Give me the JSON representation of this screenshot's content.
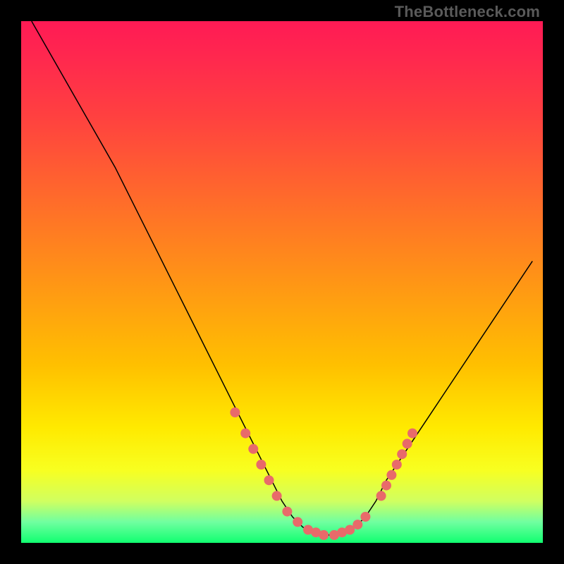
{
  "watermark": "TheBottleneck.com",
  "chart_data": {
    "type": "line",
    "title": "",
    "xlabel": "",
    "ylabel": "",
    "xlim": [
      0,
      100
    ],
    "ylim": [
      0,
      100
    ],
    "series": [
      {
        "name": "curve",
        "x": [
          2,
          6,
          10,
          14,
          18,
          22,
          26,
          30,
          34,
          38,
          42,
          46,
          50,
          52,
          54,
          56,
          58,
          60,
          62,
          64,
          66,
          68,
          70,
          74,
          78,
          82,
          86,
          90,
          94,
          98
        ],
        "y": [
          100,
          93,
          86,
          79,
          72,
          64,
          56,
          48,
          40,
          32,
          24,
          16,
          8,
          5,
          3,
          2,
          1.5,
          1.5,
          2,
          3,
          5,
          8,
          12,
          18,
          24,
          30,
          36,
          42,
          48,
          54
        ]
      }
    ],
    "markers": {
      "name": "highlighted-points",
      "color": "#e86a6a",
      "points": [
        {
          "x": 41,
          "y": 25
        },
        {
          "x": 43,
          "y": 21
        },
        {
          "x": 44.5,
          "y": 18
        },
        {
          "x": 46,
          "y": 15
        },
        {
          "x": 47.5,
          "y": 12
        },
        {
          "x": 49,
          "y": 9
        },
        {
          "x": 51,
          "y": 6
        },
        {
          "x": 53,
          "y": 4
        },
        {
          "x": 55,
          "y": 2.5
        },
        {
          "x": 56.5,
          "y": 2
        },
        {
          "x": 58,
          "y": 1.5
        },
        {
          "x": 60,
          "y": 1.5
        },
        {
          "x": 61.5,
          "y": 2
        },
        {
          "x": 63,
          "y": 2.5
        },
        {
          "x": 64.5,
          "y": 3.5
        },
        {
          "x": 66,
          "y": 5
        },
        {
          "x": 69,
          "y": 9
        },
        {
          "x": 70,
          "y": 11
        },
        {
          "x": 71,
          "y": 13
        },
        {
          "x": 72,
          "y": 15
        },
        {
          "x": 73,
          "y": 17
        },
        {
          "x": 74,
          "y": 19
        },
        {
          "x": 75,
          "y": 21
        }
      ]
    }
  }
}
